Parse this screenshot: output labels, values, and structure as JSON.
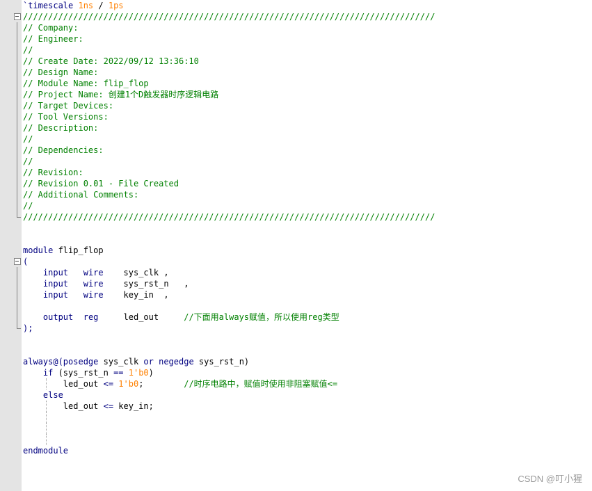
{
  "editor": {
    "language": "verilog",
    "cursor_line": 42,
    "colors": {
      "keyword": "#000080",
      "comment": "#008000",
      "string": "#800080",
      "number": "#ff8000",
      "gutter": "#e4e4e4",
      "current_line": "#e8e8ff"
    },
    "lines": [
      {
        "fold": "",
        "tokens": [
          {
            "t": "`timescale ",
            "c": "kw"
          },
          {
            "t": "1ns",
            "c": "num"
          },
          {
            "t": " / ",
            "c": "id"
          },
          {
            "t": "1ps",
            "c": "num"
          }
        ]
      },
      {
        "fold": "box",
        "tokens": [
          {
            "t": "//////////////////////////////////////////////////////////////////////////////////",
            "c": "cm"
          }
        ]
      },
      {
        "fold": "vline",
        "tokens": [
          {
            "t": "// Company:",
            "c": "cm"
          }
        ]
      },
      {
        "fold": "vline",
        "tokens": [
          {
            "t": "// Engineer:",
            "c": "cm"
          }
        ]
      },
      {
        "fold": "vline",
        "tokens": [
          {
            "t": "//",
            "c": "cm"
          }
        ]
      },
      {
        "fold": "vline",
        "tokens": [
          {
            "t": "// Create Date: 2022/09/12 13:36:10",
            "c": "cm"
          }
        ]
      },
      {
        "fold": "vline",
        "tokens": [
          {
            "t": "// Design Name:",
            "c": "cm"
          }
        ]
      },
      {
        "fold": "vline",
        "tokens": [
          {
            "t": "// Module Name: flip_flop",
            "c": "cm"
          }
        ]
      },
      {
        "fold": "vline",
        "tokens": [
          {
            "t": "// Project Name: 创建1个D触发器时序逻辑电路",
            "c": "cm"
          }
        ]
      },
      {
        "fold": "vline",
        "tokens": [
          {
            "t": "// Target Devices:",
            "c": "cm"
          }
        ]
      },
      {
        "fold": "vline",
        "tokens": [
          {
            "t": "// Tool Versions:",
            "c": "cm"
          }
        ]
      },
      {
        "fold": "vline",
        "tokens": [
          {
            "t": "// Description:",
            "c": "cm"
          }
        ]
      },
      {
        "fold": "vline",
        "tokens": [
          {
            "t": "//",
            "c": "cm"
          }
        ]
      },
      {
        "fold": "vline",
        "tokens": [
          {
            "t": "// Dependencies:",
            "c": "cm"
          }
        ]
      },
      {
        "fold": "vline",
        "tokens": [
          {
            "t": "//",
            "c": "cm"
          }
        ]
      },
      {
        "fold": "vline",
        "tokens": [
          {
            "t": "// Revision:",
            "c": "cm"
          }
        ]
      },
      {
        "fold": "vline",
        "tokens": [
          {
            "t": "// Revision 0.01 - File Created",
            "c": "cm"
          }
        ]
      },
      {
        "fold": "vline",
        "tokens": [
          {
            "t": "// Additional Comments:",
            "c": "cm"
          }
        ]
      },
      {
        "fold": "vline",
        "tokens": [
          {
            "t": "//",
            "c": "cm"
          }
        ]
      },
      {
        "fold": "end",
        "tokens": [
          {
            "t": "//////////////////////////////////////////////////////////////////////////////////",
            "c": "cm"
          }
        ]
      },
      {
        "fold": "",
        "tokens": []
      },
      {
        "fold": "",
        "tokens": []
      },
      {
        "fold": "",
        "tokens": [
          {
            "t": "module",
            "c": "kw"
          },
          {
            "t": " flip_flop",
            "c": "id"
          }
        ]
      },
      {
        "fold": "box",
        "tokens": [
          {
            "t": "(",
            "c": "op"
          }
        ]
      },
      {
        "fold": "vline",
        "tokens": [
          {
            "t": "    ",
            "c": "id"
          },
          {
            "t": "input",
            "c": "kw"
          },
          {
            "t": "   ",
            "c": "id"
          },
          {
            "t": "wire",
            "c": "kw"
          },
          {
            "t": "    sys_clk ,",
            "c": "id"
          }
        ]
      },
      {
        "fold": "vline",
        "tokens": [
          {
            "t": "    ",
            "c": "id"
          },
          {
            "t": "input",
            "c": "kw"
          },
          {
            "t": "   ",
            "c": "id"
          },
          {
            "t": "wire",
            "c": "kw"
          },
          {
            "t": "    sys_rst_n   ,",
            "c": "id"
          }
        ]
      },
      {
        "fold": "vline",
        "tokens": [
          {
            "t": "    ",
            "c": "id"
          },
          {
            "t": "input",
            "c": "kw"
          },
          {
            "t": "   ",
            "c": "id"
          },
          {
            "t": "wire",
            "c": "kw"
          },
          {
            "t": "    key_in  ,",
            "c": "id"
          }
        ]
      },
      {
        "fold": "vline",
        "tokens": []
      },
      {
        "fold": "vline",
        "tokens": [
          {
            "t": "    ",
            "c": "id"
          },
          {
            "t": "output",
            "c": "kw"
          },
          {
            "t": "  ",
            "c": "id"
          },
          {
            "t": "reg",
            "c": "kw"
          },
          {
            "t": "     led_out     ",
            "c": "id"
          },
          {
            "t": "//下面用always赋值，所以使用reg类型",
            "c": "cm"
          }
        ]
      },
      {
        "fold": "end",
        "tokens": [
          {
            "t": ");",
            "c": "op"
          }
        ]
      },
      {
        "fold": "",
        "tokens": []
      },
      {
        "fold": "",
        "tokens": []
      },
      {
        "fold": "",
        "tokens": [
          {
            "t": "always@(posedge",
            "c": "kw"
          },
          {
            "t": " sys_clk ",
            "c": "id"
          },
          {
            "t": "or",
            "c": "kw"
          },
          {
            "t": " ",
            "c": "id"
          },
          {
            "t": "negedge",
            "c": "kw"
          },
          {
            "t": " sys_rst_n)",
            "c": "id"
          }
        ]
      },
      {
        "fold": "",
        "tokens": [
          {
            "t": "    ",
            "c": "id"
          },
          {
            "t": "if",
            "c": "kw"
          },
          {
            "t": " (sys_rst_n ",
            "c": "id"
          },
          {
            "t": "==",
            "c": "op"
          },
          {
            "t": " ",
            "c": "id"
          },
          {
            "t": "1'b0",
            "c": "num"
          },
          {
            "t": ")",
            "c": "id"
          }
        ]
      },
      {
        "fold": "",
        "guides": [
          1
        ],
        "tokens": [
          {
            "t": "        led_out ",
            "c": "id"
          },
          {
            "t": "<=",
            "c": "op"
          },
          {
            "t": " ",
            "c": "id"
          },
          {
            "t": "1'b0",
            "c": "num"
          },
          {
            "t": ";        ",
            "c": "id"
          },
          {
            "t": "//时序电路中，赋值时使用非阻塞赋值<=",
            "c": "cm"
          }
        ]
      },
      {
        "fold": "",
        "tokens": [
          {
            "t": "    ",
            "c": "id"
          },
          {
            "t": "else",
            "c": "kw"
          }
        ]
      },
      {
        "fold": "",
        "guides": [
          1
        ],
        "tokens": [
          {
            "t": "        led_out ",
            "c": "id"
          },
          {
            "t": "<=",
            "c": "op"
          },
          {
            "t": " key_in;",
            "c": "id"
          }
        ]
      },
      {
        "fold": "",
        "guides": [
          1
        ],
        "tokens": []
      },
      {
        "fold": "",
        "guides": [
          1
        ],
        "tokens": []
      },
      {
        "fold": "",
        "guides": [
          1
        ],
        "tokens": []
      },
      {
        "fold": "",
        "tokens": [
          {
            "t": "endmodule",
            "c": "kw"
          }
        ]
      },
      {
        "fold": "",
        "tokens": []
      }
    ]
  },
  "watermark": "CSDN @叮小猩"
}
